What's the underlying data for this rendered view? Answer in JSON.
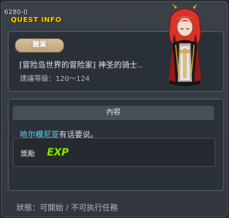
{
  "quest": {
    "id": "6280-0",
    "header_label": "QUEST INFO",
    "job_badge": "職業",
    "job_text": "[冒险岛世界的冒险家] 神圣的骑士..",
    "level_text": "建議等級：120～124",
    "section_title": "內容",
    "npc_name": "哈尔模尼亚",
    "content_rest": "有话要说。",
    "reward_label": "獎勵",
    "reward_icon_text": "EXP",
    "status_text": "狀態：可開始 / 不可执行任務"
  },
  "colors": {
    "title_yellow": "#ffcc00",
    "npc_cyan": "#66d9ff",
    "exp_green": "#8fe000",
    "badge_tan": "#c9ae86"
  },
  "icons": {
    "portrait": "red-haired-knight-portrait",
    "reward": "exp-icon"
  }
}
